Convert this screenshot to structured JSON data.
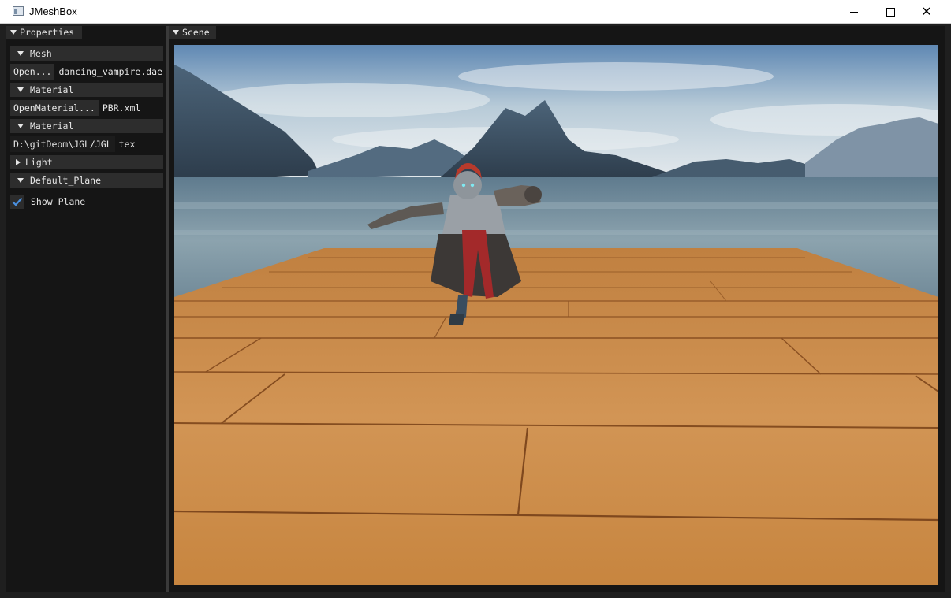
{
  "window": {
    "title": "JMeshBox",
    "minimize_icon": "minimize-icon",
    "maximize_icon": "maximize-icon",
    "close_icon": "close-icon",
    "close_glyph": "✕"
  },
  "properties": {
    "tab_label": "Properties",
    "sections": {
      "mesh": {
        "header": "Mesh",
        "button": "Open...",
        "value": "dancing_vampire.dae"
      },
      "material1": {
        "header": "Material",
        "button": "OpenMaterial...",
        "value": "PBR.xml"
      },
      "material2": {
        "header": "Material",
        "path": "D:\\gitDeom\\JGL/JGL",
        "label": "tex"
      },
      "light": {
        "header": "Light",
        "expanded": false
      },
      "default_plane": {
        "header": "Default_Plane",
        "show_plane_label": "Show Plane",
        "show_plane_checked": true
      }
    }
  },
  "scene": {
    "tab_label": "Scene"
  },
  "colors": {
    "checkbox_accent": "#4a90e0",
    "panel_bg": "#151515",
    "header_bg": "#2d2d2d",
    "floor_wood": "#c98a48",
    "water": "#8aa1ad",
    "sky": "#c9d6df"
  }
}
